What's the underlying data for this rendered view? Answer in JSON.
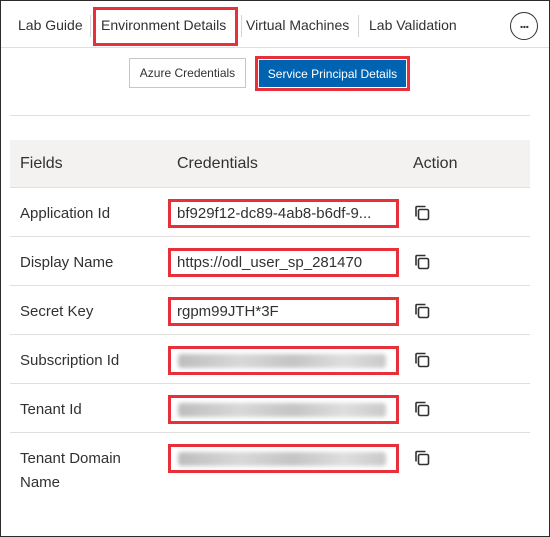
{
  "tabs": {
    "items": [
      "Lab Guide",
      "Environment Details",
      "Virtual Machines",
      "Lab Validation"
    ],
    "active": "Environment Details",
    "more_icon": "ellipsis-icon"
  },
  "sub_buttons": {
    "azure_credentials": "Azure Credentials",
    "service_principal_details": "Service Principal Details",
    "active_color": "#0063b1"
  },
  "table": {
    "headers": {
      "fields": "Fields",
      "credentials": "Credentials",
      "action": "Action"
    },
    "rows": [
      {
        "field": "Application Id",
        "value": "bf929f12-dc89-4ab8-b6df-9...",
        "masked": false,
        "action_icon": "copy-icon"
      },
      {
        "field": "Display Name",
        "value": "https://odl_user_sp_281470",
        "masked": false,
        "action_icon": "copy-icon"
      },
      {
        "field": "Secret Key",
        "value": "rgpm99JTH*3F",
        "masked": false,
        "action_icon": "copy-icon"
      },
      {
        "field": "Subscription Id",
        "value": "",
        "masked": true,
        "action_icon": "copy-icon"
      },
      {
        "field": "Tenant Id",
        "value": "",
        "masked": true,
        "action_icon": "copy-icon"
      },
      {
        "field": "Tenant Domain Name",
        "value": "",
        "masked": true,
        "action_icon": "copy-icon"
      }
    ]
  },
  "colors": {
    "highlight": "#e8303a",
    "header_bg": "#f3f2f1"
  }
}
